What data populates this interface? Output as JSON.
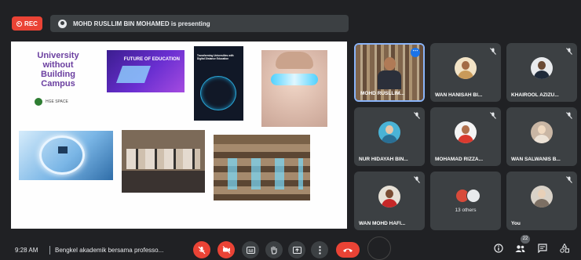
{
  "top_bar": {
    "rec_label": "REC",
    "presenter_text": "MOHD RUSLLIM BIN MOHAMED is presenting"
  },
  "slide": {
    "logo_title": "University without Building Campus",
    "logo_brand": "HGE SPACE",
    "future_education_text": "FUTURE OF EDUCATION",
    "book_title": "Transforming Universities with Digital Distance Education"
  },
  "participants": [
    {
      "name": "MOHD RUSLLIM...",
      "muted": false,
      "video": true
    },
    {
      "name": "WAN HANISAH BI...",
      "muted": true
    },
    {
      "name": "KHAIROOL AZIZU...",
      "muted": true
    },
    {
      "name": "NUR HIDAYAH BIN...",
      "muted": true
    },
    {
      "name": "MOHAMAD RIZZA...",
      "muted": true
    },
    {
      "name": "WAN SALWANIS B...",
      "muted": true
    },
    {
      "name": "WAN MOHD HAFI...",
      "muted": true
    },
    {
      "name": "13 others",
      "muted": false
    },
    {
      "name": "You",
      "muted": true
    }
  ],
  "bottom_bar": {
    "time": "9:28 AM",
    "meeting_title": "Bengkel akademik bersama professo...",
    "participant_count": "22"
  },
  "colors": {
    "background": "#202124",
    "tile": "#3c4043",
    "red": "#ea4335",
    "active_border": "#8ab4f8"
  }
}
